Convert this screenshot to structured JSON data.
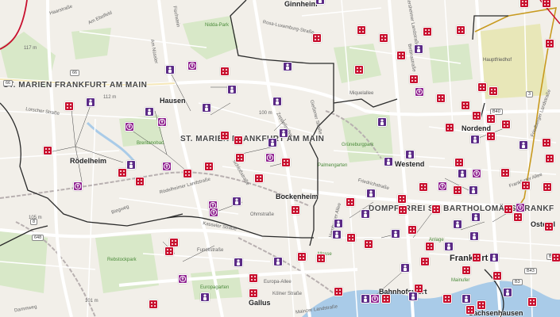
{
  "colors": {
    "land": "#f2efe9",
    "park": "#d8e8c8",
    "road": "#ffffff",
    "boundary": "#333333",
    "rail": "#b0aaaa",
    "river": "#a9cbe8",
    "cemetery_outline": "#c89a1e",
    "marker_church": "#c8102e",
    "marker_person": "#5b2a86",
    "marker_figure": "#8e1f8e"
  },
  "places": {
    "ginnheim": "Ginnheim",
    "hausen": "Hausen",
    "roedelheim": "Rödelheim",
    "bockenheim": "Bockenheim",
    "nordend": "Nordend",
    "westend": "Westend",
    "ostend": "Ostend",
    "frankfurt": "Frankfurt",
    "gallus": "Gallus",
    "bahnhofsviertel": "Bahnhofsviert",
    "sachsenhausen": "Sachsenhausen"
  },
  "parishes": {
    "marien_1": "ST. MARIEN FRANKFURT AM MAIN",
    "marien_2": "ST. MARIEN FRANKFURT AM MAIN",
    "dom": "DOMPFARREI ST. BARTHOLOMÄUS FRANKF"
  },
  "streets": {
    "s1": "Haarstraße",
    "s2": "Am Ebelfeld",
    "s3": "Fischstein",
    "s4": "Am Nüssler",
    "s5": "Nidda-Park",
    "s6": "Rosa-Luxemburg-Straße",
    "s7": "Eschersheimer Landstraße",
    "s8": "Hauptfriedhof",
    "s9": "Lorscher Straße",
    "s10": "Miquelallee",
    "s11": "Zeppelinallee",
    "s12": "Grüneburgpark",
    "s13": "Brentanobad",
    "s14": "Schloßstraße",
    "s15": "Palmengarten",
    "s16": "Rödelheimer Landstraße",
    "s17": "Ohmstraße",
    "s18": "Biegweg",
    "s19": "Friedrichstraße",
    "s20": "Kasseler Straße",
    "s21": "Rebstockpark",
    "s22": "Europagarten",
    "s23": "Europa-Allee",
    "s24": "Mainzer Landstraße",
    "s25": "Messe",
    "s26": "Anlage",
    "s27": "Mainufer",
    "s28": "Dammweg",
    "s29": "Hamburger Allee",
    "s30": "Funckstraße",
    "s31": "Gießener Straße",
    "s32": "Kölner Straße",
    "s33": "Friedberger Landstraße",
    "s34": "Bettinastraße",
    "s35": "Frankfurter Allee"
  },
  "road_numbers": {
    "r66a": "66",
    "r66b": "66",
    "r8a": "8",
    "r648": "648",
    "r40": "B40",
    "r40b": "B40",
    "r44": "B44",
    "r43": "B43",
    "r3": "B3",
    "r1": "3",
    "rB8": "B8"
  },
  "elevations": {
    "e1": "117 m",
    "e2": "112 m",
    "e3": "100 m",
    "e4": "105 m",
    "e5": "101 m",
    "e6": "117 m"
  },
  "marker_legend": {
    "church": "church-marker",
    "person": "person-marker",
    "figure": "figure-marker"
  }
}
